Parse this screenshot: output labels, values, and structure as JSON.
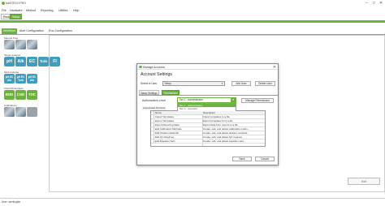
{
  "app": {
    "title": "MASTECH PRO"
  },
  "window_controls": {
    "minimize": "–",
    "maximize": "□",
    "close": "✕"
  },
  "menu": [
    "File",
    "Hardware",
    "Method",
    "Reporting",
    "Utilities",
    "Help"
  ],
  "top_tabs": [
    "Recipe",
    "Setup"
  ],
  "sub_tabs": [
    "Workflow",
    "Alert Configuration",
    "Run Configuration"
  ],
  "left_panel": {
    "groups": [
      {
        "label": "Sample Prep"
      },
      {
        "label": "Single Analysis"
      },
      {
        "label": "Multi Analysis"
      },
      {
        "label": "OSC/OD Analysis"
      },
      {
        "label": "Calibrations"
      }
    ],
    "tiles_row2": [
      "pH",
      "Alk",
      "EC",
      "Turb",
      "Fl"
    ],
    "tiles_row3": [
      "pH EC Alk",
      "pH EC Turb",
      "pH EC Alk"
    ],
    "tiles_row4": [
      "BOD",
      "COD",
      "TOC"
    ]
  },
  "exit_label": "Exit",
  "footer": {
    "user": "User: sterlinglab"
  },
  "dialog": {
    "title": "Manage Accounts",
    "close": "✕",
    "heading": "Account Settings",
    "select_user_label": "Select a User",
    "selected_user": "Setup",
    "add_user": "Add User",
    "delete_user": "Delete User",
    "tabs": [
      "Basic Settings",
      "Permissions"
    ],
    "auth_label": "Authorization Level",
    "auth_value": "Tier 1 - Administrator",
    "dropdown_options": [
      "Tier 1 - Administrator",
      "Tier 2 - Operator"
    ],
    "manage_permissions": "Manage Permissions",
    "associated_label": "Associated Permiss",
    "grid_headers": [
      "Name",
      "Description"
    ],
    "grid_rows": [
      [
        "Import Templates",
        "Import templates to a file"
      ],
      [
        "Export Templates",
        "Export templates from a file"
      ],
      [
        "Export Reporting Data",
        "Export data from reports to a file"
      ],
      [
        "Edit Calibration Methods",
        "Create, edit, and delete calibration metho..."
      ],
      [
        "Edit Titration Methods",
        "Create, edit, and delete titration methods..."
      ],
      [
        "Edit QC Regimes",
        "Create, edit, and delete QC regimes."
      ],
      [
        "Edit Equation Sets",
        "Create, edit, and delete equation sets..."
      ]
    ],
    "save": "Save",
    "cancel": "Cancel"
  },
  "colors": {
    "accent": "#6cb33e",
    "tile_blue": "#3f9dbf"
  }
}
